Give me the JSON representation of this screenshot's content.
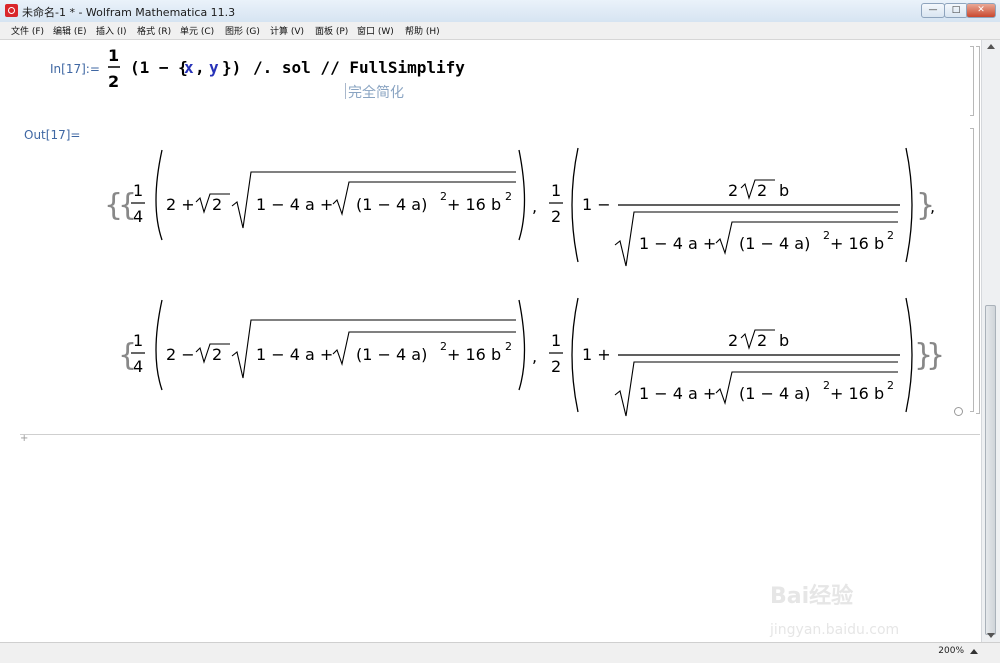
{
  "window": {
    "title": "未命名-1 * - Wolfram Mathematica 11.3",
    "minimize": "—",
    "maximize": "□",
    "close": "✕"
  },
  "menu": [
    "文件 (F)",
    "编辑 (E)",
    "插入 (I)",
    "格式 (R)",
    "单元 (C)",
    "图形 (G)",
    "计算 (V)",
    "面板 (P)",
    "窗口 (W)",
    "帮助 (H)"
  ],
  "cell": {
    "in_label": "In[17]:=",
    "out_label": "Out[17]=",
    "input_tail": "/. sol // FullSimplify",
    "hint": "完全简化"
  },
  "output": {
    "a_frac": "1",
    "b_frac": "4",
    "half_num": "1",
    "half_den": "2",
    "plus2": "2 +",
    "minus2": "2 −",
    "sqrt2": "2",
    "inner": "1 − 4 a +",
    "innersq": "(1 − 4 a)",
    "exp2": "2",
    "tail": "+ 16 b",
    "num": "2",
    "num_b": "b",
    "one_minus": "1 −",
    "one_plus": "1 +"
  },
  "status": {
    "zoom": "200%"
  },
  "watermark": {
    "text": "Bai经验",
    "url": "jingyan.baidu.com"
  }
}
